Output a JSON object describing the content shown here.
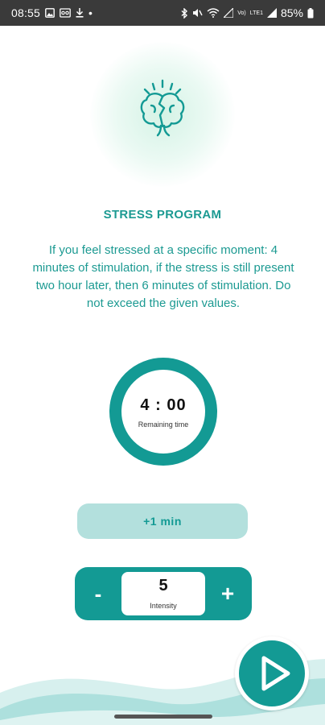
{
  "status_bar": {
    "time": "08:55",
    "notification_dot": "•",
    "network_label_top": "Vo)",
    "network_label_mid": "LTE1",
    "battery": "85%"
  },
  "program": {
    "title": "STRESS PROGRAM",
    "description": "If you feel stressed at a specific moment: 4 minutes of stimulation, if the stress is still present two hour later, then 6 minutes of stimulation. Do not exceed the given values."
  },
  "timer": {
    "value": "4 : 00",
    "label": "Remaining time"
  },
  "add_minute_label": "+1 min",
  "intensity": {
    "minus_label": "-",
    "value": "5",
    "label": "Intensity",
    "plus_label": "+"
  },
  "icons": {
    "program": "brain-stress-icon",
    "play": "play-icon"
  },
  "colors": {
    "accent": "#139a94",
    "accent_light": "#b3e0dd",
    "text_accent": "#1c9a92"
  }
}
